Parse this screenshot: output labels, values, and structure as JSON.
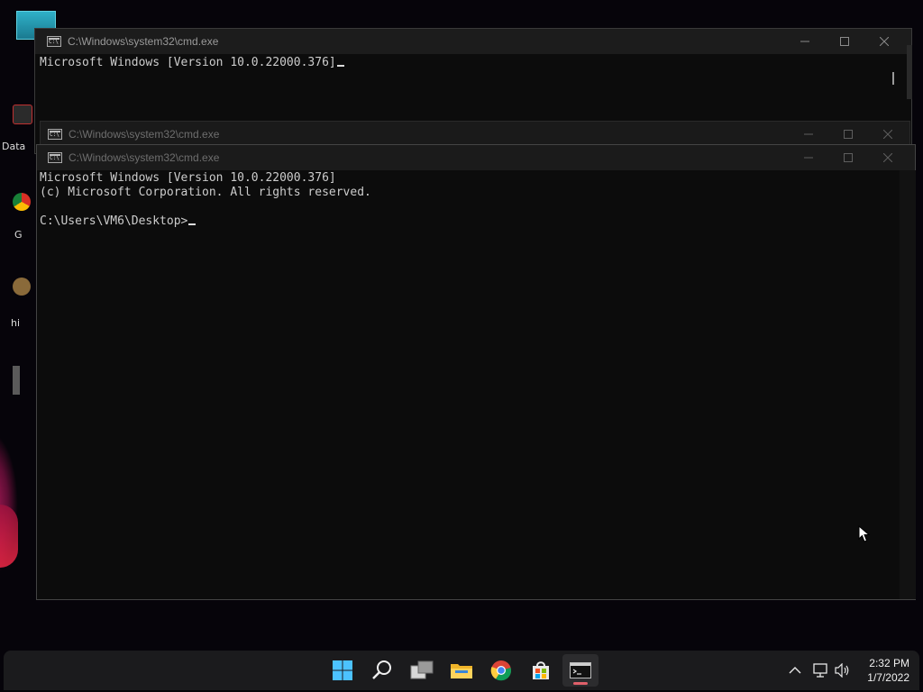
{
  "desktop": {
    "icons": [
      {
        "label": "Data",
        "icon": "data-icon"
      },
      {
        "label": "G",
        "icon": "chrome-icon"
      },
      {
        "label": "hi",
        "icon": "app-icon"
      }
    ]
  },
  "windows": [
    {
      "title": "C:\\Windows\\system32\\cmd.exe",
      "state": "background",
      "lines": [
        "Microsoft Windows [Version 10.0.22000.376]"
      ]
    },
    {
      "title": "C:\\Windows\\system32\\cmd.exe",
      "state": "background"
    },
    {
      "title": "C:\\Windows\\system32\\cmd.exe",
      "state": "focused",
      "lines": [
        "Microsoft Windows [Version 10.0.22000.376]",
        "(c) Microsoft Corporation. All rights reserved.",
        "",
        "C:\\Users\\VM6\\Desktop>"
      ]
    }
  ],
  "taskbar": {
    "apps": [
      {
        "name": "start",
        "icon": "windows-start-icon"
      },
      {
        "name": "search",
        "icon": "search-icon"
      },
      {
        "name": "task-view",
        "icon": "task-view-icon"
      },
      {
        "name": "file-explorer",
        "icon": "folder-icon"
      },
      {
        "name": "chrome",
        "icon": "chrome-icon"
      },
      {
        "name": "store",
        "icon": "store-icon"
      },
      {
        "name": "terminal",
        "icon": "cmd-icon",
        "active": true
      }
    ],
    "tray": [
      "chevron-up-icon",
      "network-icon",
      "volume-icon"
    ],
    "clock": {
      "time": "2:32 PM",
      "date": "1/7/2022"
    }
  },
  "colors": {
    "console_bg": "#0c0c0c",
    "console_text": "#cccccc",
    "titlebar": "#1c1c1c",
    "taskbar": "#1b1b1d",
    "active_indicator": "#e0606a"
  }
}
